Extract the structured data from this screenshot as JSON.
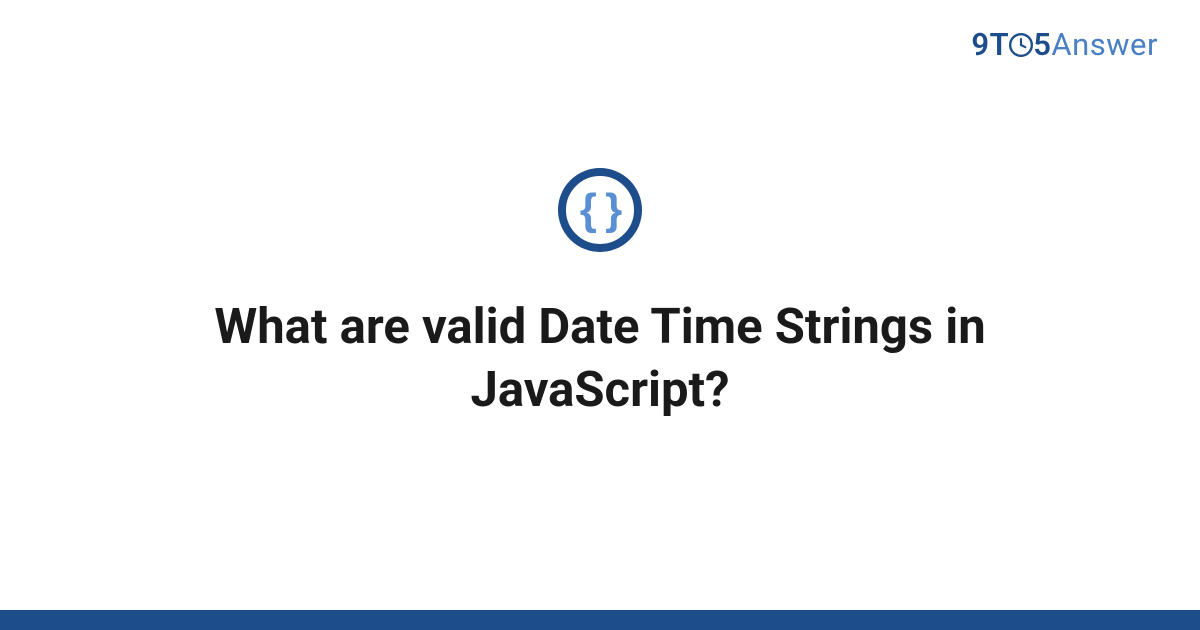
{
  "brand": {
    "part1": "9",
    "part2": "T",
    "part3": "5",
    "part4": "Answer"
  },
  "icon": {
    "braces": "{ }",
    "ring_color": "#1e4d8b",
    "brace_color": "#5a8fd4"
  },
  "title": "What are valid Date Time Strings in JavaScript?",
  "colors": {
    "accent_dark": "#1e4d8b",
    "accent_light": "#4a7fc4",
    "text": "#1a1a1a",
    "background": "#ffffff"
  }
}
